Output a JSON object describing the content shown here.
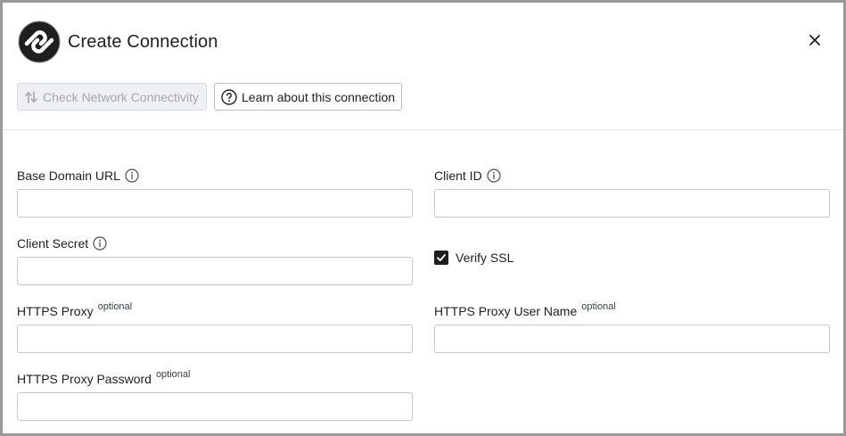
{
  "dialog": {
    "title": "Create Connection",
    "close_icon": "close-icon",
    "logo_icon": "connector-logo-icon"
  },
  "toolbar": {
    "check_network_label": "Check Network Connectivity",
    "check_network_icon": "network-arrows-icon",
    "check_network_disabled": true,
    "learn_label": "Learn about this connection",
    "learn_icon": "question-circle-icon"
  },
  "form": {
    "base_domain_url": {
      "label": "Base Domain URL",
      "value": "",
      "info_icon": "info-icon"
    },
    "client_id": {
      "label": "Client ID",
      "value": "",
      "info_icon": "info-icon"
    },
    "client_secret": {
      "label": "Client Secret",
      "value": "",
      "info_icon": "info-icon"
    },
    "verify_ssl": {
      "label": "Verify SSL",
      "checked": true
    },
    "https_proxy": {
      "label": "HTTPS Proxy",
      "optional": "optional",
      "value": ""
    },
    "https_proxy_user_name": {
      "label": "HTTPS Proxy User Name",
      "optional": "optional",
      "value": ""
    },
    "https_proxy_password": {
      "label": "HTTPS Proxy Password",
      "optional": "optional",
      "value": ""
    }
  },
  "colors": {
    "text": "#1f1f1f",
    "disabled_text": "#a4a8b0",
    "disabled_bg": "#eef0f3",
    "border": "#c4c8ce",
    "checkbox": "#1f1f1f"
  }
}
